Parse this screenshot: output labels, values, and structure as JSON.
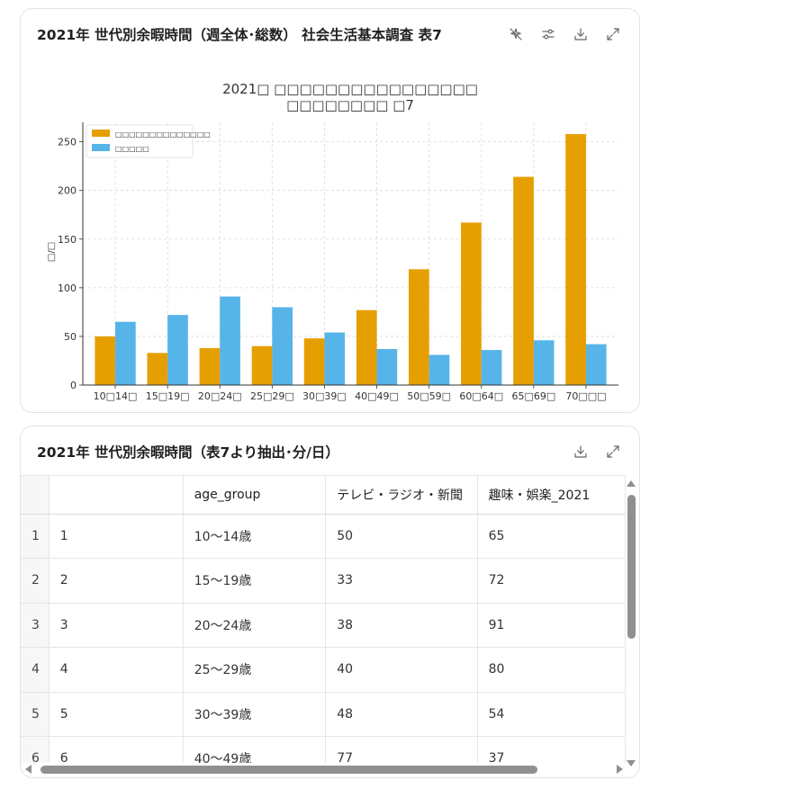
{
  "chart_card": {
    "title": "2021年 世代別余暇時間（週全体･総数） 社会生活基本調査 表7",
    "icons": [
      "sparkle-off-icon",
      "settings-sliders-icon",
      "download-icon",
      "expand-icon"
    ]
  },
  "chart_data": {
    "type": "bar",
    "title_line1": "2021□ □□□□□□□□□□□□□□□□",
    "title_line2": "□□□□□□□□ □7",
    "ylabel": "□/□",
    "xlabel": "",
    "ylim": [
      0,
      270
    ],
    "yticks": [
      0,
      50,
      100,
      150,
      200,
      250
    ],
    "grid": true,
    "legend_position": "top-left",
    "categories": [
      "10□14□",
      "15□19□",
      "20□24□",
      "25□29□",
      "30□39□",
      "40□49□",
      "50□59□",
      "60□64□",
      "65□69□",
      "70□□□"
    ],
    "series": [
      {
        "name": "□□□□□□□□□□□□□□",
        "color": "#e69f00",
        "values": [
          50,
          33,
          38,
          40,
          48,
          77,
          119,
          167,
          214,
          258
        ]
      },
      {
        "name": "□□□□□",
        "color": "#56b4e9",
        "values": [
          65,
          72,
          91,
          80,
          54,
          37,
          31,
          36,
          46,
          42
        ]
      }
    ]
  },
  "table_card": {
    "title": "2021年 世代別余暇時間（表7より抽出･分/日）",
    "icons": [
      "download-icon",
      "expand-icon"
    ],
    "columns": [
      "",
      "",
      "age_group",
      "テレビ・ラジオ・新聞",
      "趣味・娯楽_2021"
    ],
    "rows": [
      [
        "1",
        "1",
        "10〜14歳",
        "50",
        "65"
      ],
      [
        "2",
        "2",
        "15〜19歳",
        "33",
        "72"
      ],
      [
        "3",
        "3",
        "20〜24歳",
        "38",
        "91"
      ],
      [
        "4",
        "4",
        "25〜29歳",
        "40",
        "80"
      ],
      [
        "5",
        "5",
        "30〜39歳",
        "48",
        "54"
      ],
      [
        "6",
        "6",
        "40〜49歳",
        "77",
        "37"
      ]
    ]
  }
}
